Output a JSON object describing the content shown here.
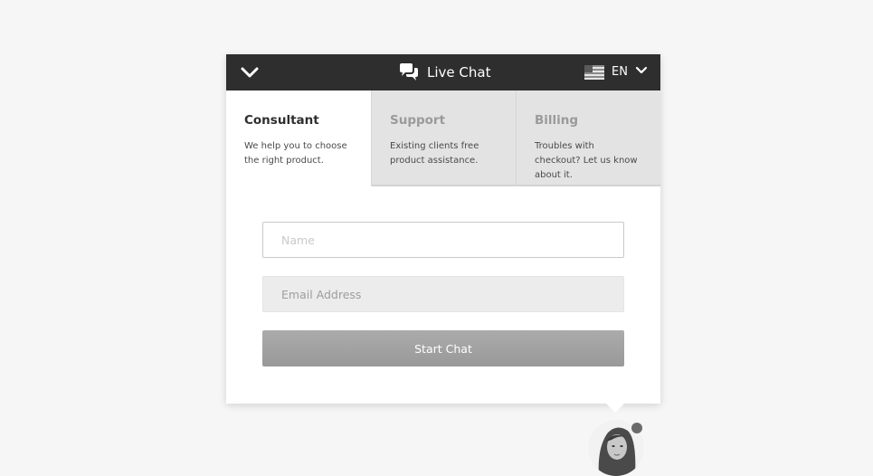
{
  "header": {
    "title": "Live Chat",
    "language": "EN",
    "collapse_icon": "chevron-down-icon",
    "chat_icon": "chat-bubbles-icon",
    "flag_icon": "us-flag-icon",
    "background_color": "#2e2e2e"
  },
  "tabs": [
    {
      "title": "Consultant",
      "description": "We help you to choose the right product.",
      "active": true
    },
    {
      "title": "Support",
      "description": "Existing clients free product assistance.",
      "active": false
    },
    {
      "title": "Billing",
      "description": "Troubles with checkout? Let us know about it.",
      "active": false
    }
  ],
  "form": {
    "name": {
      "placeholder": "Name",
      "value": ""
    },
    "email": {
      "placeholder": "Email Address",
      "value": ""
    },
    "submit_label": "Start Chat"
  },
  "agent": {
    "avatar_icon": "agent-avatar",
    "status_color": "#6b6b6b"
  }
}
